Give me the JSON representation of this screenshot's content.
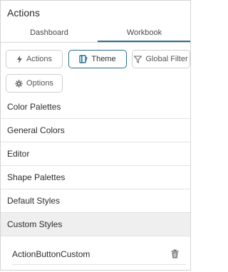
{
  "panel": {
    "title": "Actions"
  },
  "tabs": [
    {
      "label": "Dashboard",
      "active": false
    },
    {
      "label": "Workbook",
      "active": true
    }
  ],
  "toolbar": {
    "actions": {
      "label": "Actions",
      "icon": "lightning-icon"
    },
    "theme": {
      "label": "Theme",
      "icon": "theme-book-icon",
      "active": true
    },
    "global_filter": {
      "label": "Global Filter",
      "icon": "filter-icon"
    },
    "options": {
      "label": "Options",
      "icon": "gear-icon"
    }
  },
  "menu": {
    "items": [
      {
        "label": "Color Palettes"
      },
      {
        "label": "General Colors"
      },
      {
        "label": "Editor"
      },
      {
        "label": "Shape Palettes"
      },
      {
        "label": "Default Styles"
      },
      {
        "label": "Custom Styles",
        "selected": true
      }
    ]
  },
  "custom_styles": {
    "items": [
      {
        "label": "ActionButtonCustom",
        "action_icon": "trash-icon"
      }
    ]
  },
  "colors": {
    "accent": "#2b6f90",
    "selected_bg": "#efefef",
    "border": "#cfcfcf"
  }
}
